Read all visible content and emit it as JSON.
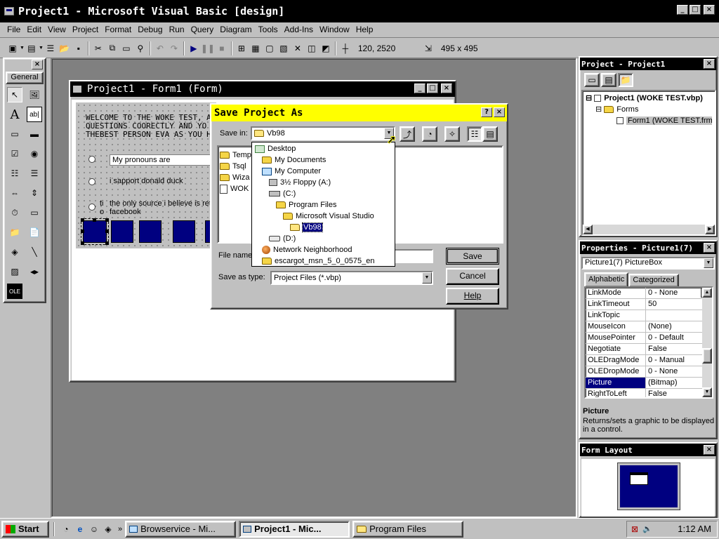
{
  "main_window": {
    "title": "Project1 - Microsoft Visual Basic [design]"
  },
  "menu": [
    "File",
    "Edit",
    "View",
    "Project",
    "Format",
    "Debug",
    "Run",
    "Query",
    "Diagram",
    "Tools",
    "Add-Ins",
    "Window",
    "Help"
  ],
  "toolbar": {
    "position": "120, 2520",
    "size": "495 x 495"
  },
  "toolbox": {
    "tab": "General"
  },
  "form_window": {
    "title": "Project1 - Form1 (Form)",
    "welcome_lines": [
      "WELCOME TO THE WOKE TEST, A",
      "QUESTIONS COORECTLY AND YO",
      "THEBEST PERSON EVA AS YOU H"
    ],
    "textbox_value": "My pronouns are",
    "options": [
      "i sapport donald duck",
      "the only source i believe is reta",
      "facebook"
    ],
    "option_prefix": [
      "ti",
      "o"
    ]
  },
  "save_dialog": {
    "title": "Save Project As",
    "save_in_label": "Save in:",
    "save_in_value": "Vb98",
    "file_list": [
      "Temp",
      "Tsql",
      "Wiza",
      "WOK"
    ],
    "dropdown_items": [
      "Desktop",
      "My Documents",
      "My Computer",
      "3½ Floppy (A:)",
      "(C:)",
      "Program Files",
      "Microsoft Visual Studio",
      "Vb98",
      "(D:)",
      "Network Neighborhood",
      "escargot_msn_5_0_0575_en"
    ],
    "file_name_label": "File name",
    "save_as_type_label": "Save as type:",
    "save_as_type_value": "Project Files (*.vbp)",
    "buttons": {
      "save": "Save",
      "cancel": "Cancel",
      "help": "Help"
    }
  },
  "project_panel": {
    "title": "Project - Project1",
    "tree": [
      "Project1 (WOKE TEST.vbp)",
      "Forms",
      "Form1 (WOKE TEST.frm"
    ]
  },
  "properties_panel": {
    "title": "Properties - Picture1(7)",
    "object": "Picture1(7) PictureBox",
    "tabs": [
      "Alphabetic",
      "Categorized"
    ],
    "rows": [
      {
        "k": "LinkMode",
        "v": "0 - None"
      },
      {
        "k": "LinkTimeout",
        "v": "50"
      },
      {
        "k": "LinkTopic",
        "v": ""
      },
      {
        "k": "MouseIcon",
        "v": "(None)"
      },
      {
        "k": "MousePointer",
        "v": "0 - Default"
      },
      {
        "k": "Negotiate",
        "v": "False"
      },
      {
        "k": "OLEDragMode",
        "v": "0 - Manual"
      },
      {
        "k": "OLEDropMode",
        "v": "0 - None"
      },
      {
        "k": "Picture",
        "v": "(Bitmap)"
      },
      {
        "k": "RightToLeft",
        "v": "False"
      }
    ],
    "desc_title": "Picture",
    "desc_text": "Returns/sets a graphic to be displayed in a control."
  },
  "form_layout": {
    "title": "Form Layout"
  },
  "taskbar": {
    "start": "Start",
    "tasks": [
      "Browservice - Mi...",
      "Project1 - Mic...",
      "Program Files"
    ],
    "clock": "1:12 AM"
  },
  "colors": {
    "title_active": "#000000",
    "dialog_title": "#ffff00",
    "selection": "#000080",
    "desktop": "#808080"
  }
}
